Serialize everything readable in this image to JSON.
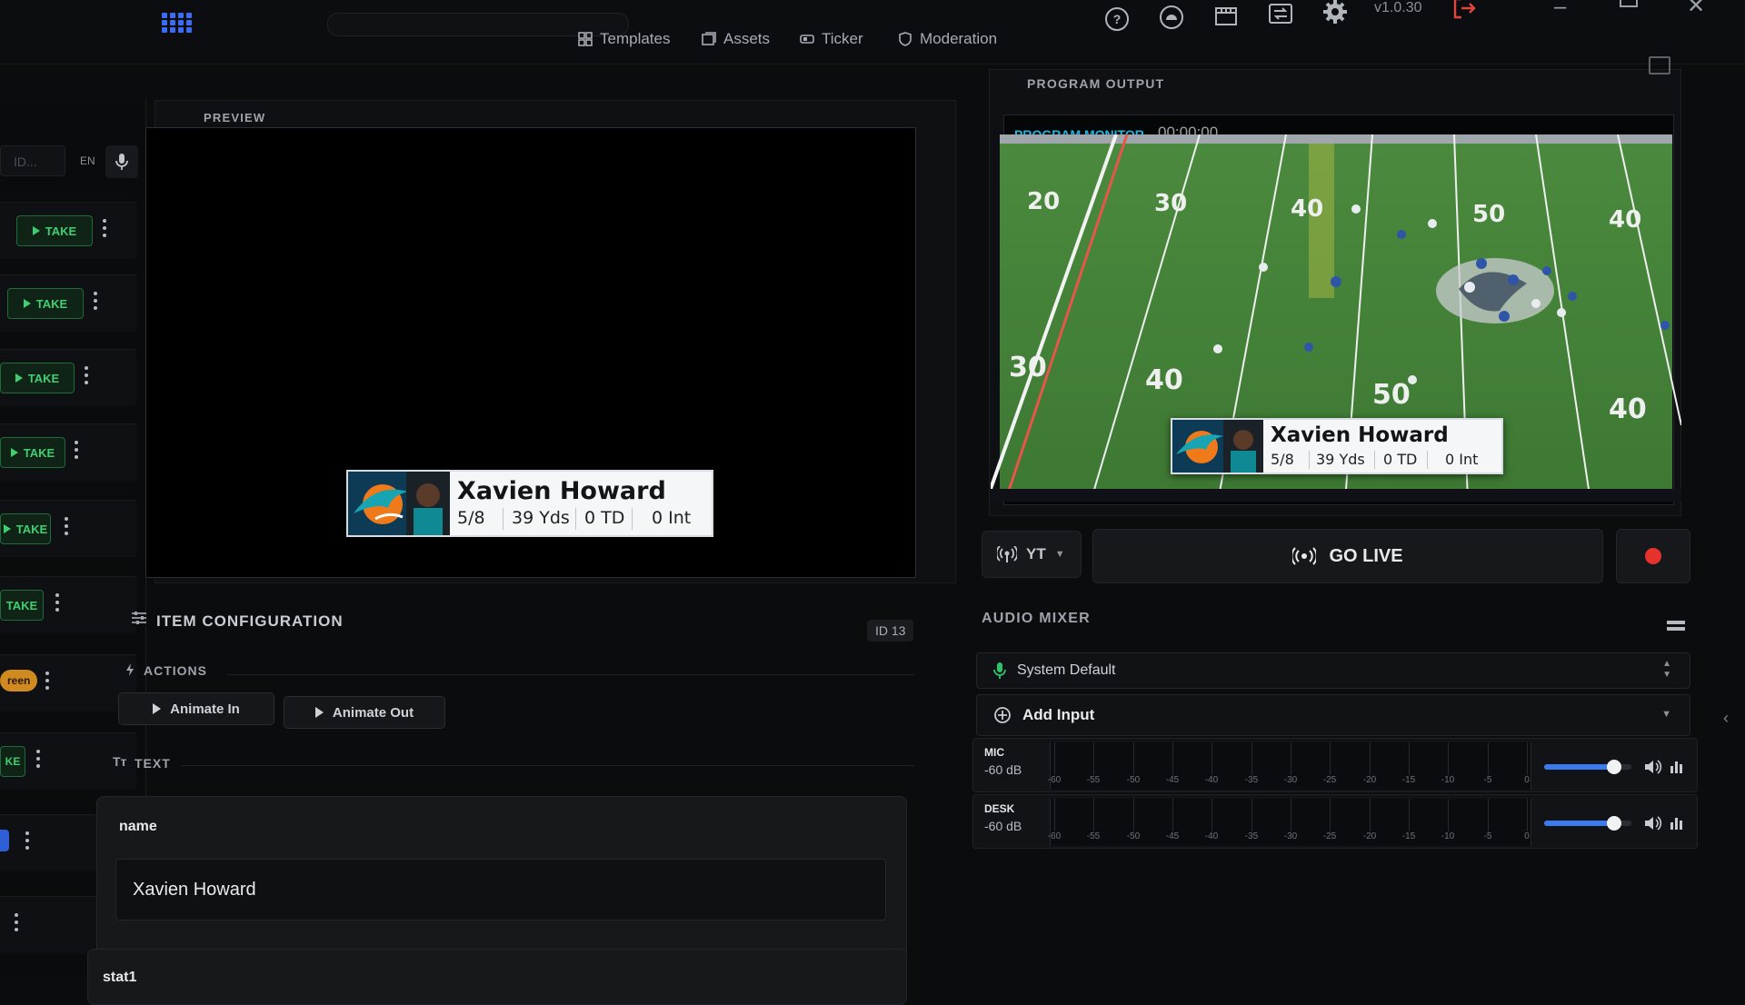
{
  "header": {
    "tabs": [
      {
        "label": "Templates",
        "icon": "grid-icon"
      },
      {
        "label": "Assets",
        "icon": "image-icon"
      },
      {
        "label": "Ticker",
        "icon": "ticker-icon"
      },
      {
        "label": "Moderation",
        "icon": "shield-icon"
      }
    ],
    "tools": [
      "help-icon",
      "stream-key-icon",
      "store-icon",
      "switch-icon",
      "gear-icon"
    ],
    "version": "v1.0.30"
  },
  "rundown": {
    "id_placeholder": "ID...",
    "language": "EN",
    "take_label": "TAKE",
    "partial_labels": [
      "KE",
      "AKE",
      "reen"
    ]
  },
  "preview": {
    "label": "PREVIEW",
    "lower_third": {
      "name": "Xavien Howard",
      "stats": [
        "5/8",
        "39 Yds",
        "0 TD",
        "0 Int"
      ]
    }
  },
  "config": {
    "title": "ITEM CONFIGURATION",
    "id_badge": "ID 13",
    "actions_label": "ACTIONS",
    "animate_in": "Animate In",
    "animate_out": "Animate Out",
    "text_label": "TEXT",
    "fields": [
      {
        "label": "name",
        "value": "Xavien Howard"
      },
      {
        "label": "stat1",
        "value": ""
      }
    ]
  },
  "program": {
    "label": "PROGRAM OUTPUT",
    "monitor_label": "PROGRAM MONITOR",
    "timecode": "00:00:00",
    "yard_numbers": [
      "20",
      "30",
      "40",
      "50",
      "40",
      "30",
      "40",
      "50",
      "40"
    ],
    "lower_third": {
      "name": "Xavien Howard",
      "stats": [
        "5/8",
        "39 Yds",
        "0 TD",
        "0 Int"
      ]
    }
  },
  "controls": {
    "destination": "YT",
    "go_live": "GO LIVE"
  },
  "audio": {
    "title": "AUDIO MIXER",
    "device": "System Default",
    "add_input": "Add Input",
    "scale": [
      "-60",
      "-55",
      "-50",
      "-45",
      "-40",
      "-35",
      "-30",
      "-25",
      "-20",
      "-15",
      "-10",
      "-5",
      "0"
    ],
    "channels": [
      {
        "name": "MIC",
        "level": "-60 dB",
        "volume": 0.8
      },
      {
        "name": "DESK",
        "level": "-60 dB",
        "volume": 0.8
      }
    ]
  },
  "colors": {
    "accent": "#3a7bf0",
    "take_green": "#3fcf72",
    "monitor_label": "#22b9e0",
    "record_red": "#e5322d",
    "field_green": "#3f7a35"
  }
}
